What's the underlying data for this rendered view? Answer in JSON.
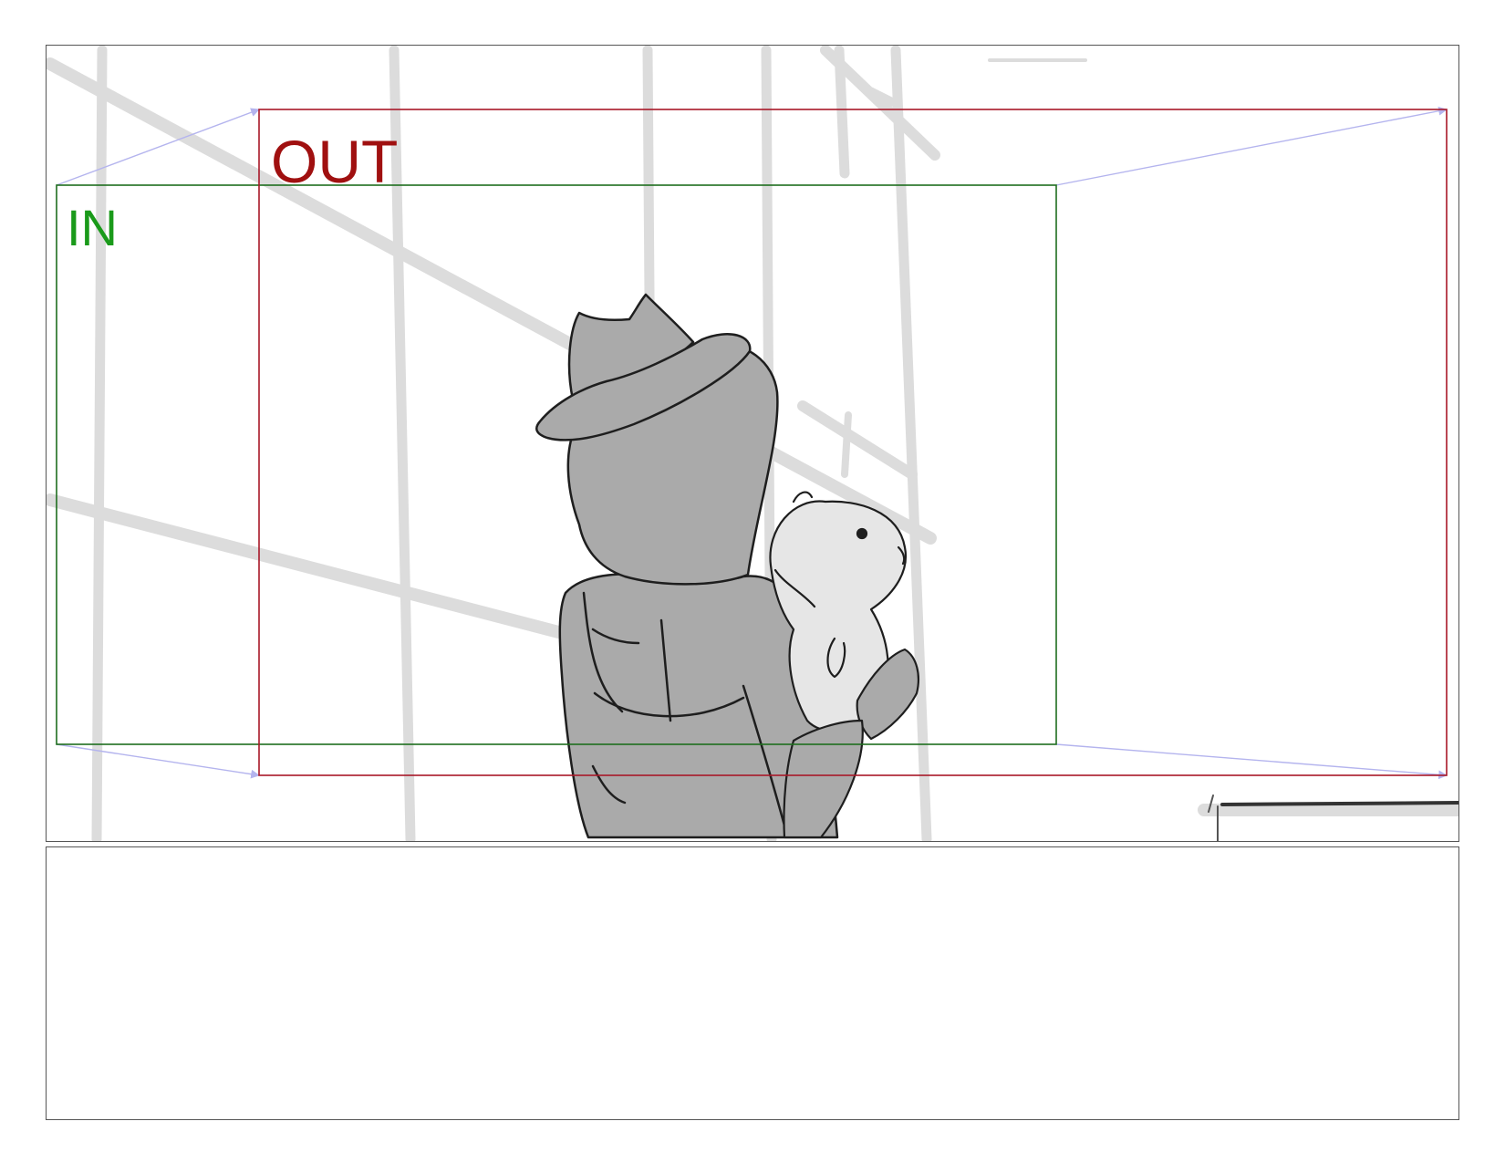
{
  "frames": {
    "in": {
      "label": "IN",
      "color": "#1a9a1a",
      "border_color": "#1f6e1f"
    },
    "out": {
      "label": "OUT",
      "color": "#a01010",
      "border_color": "#a81828"
    }
  },
  "colors": {
    "panel_border": "#555555",
    "camera_move_arrow": "#b4b4ee",
    "background_sketch": "#dcdcdc",
    "character_fill": "#aaaaaa",
    "dog_fill": "#e6e6e6",
    "ink": "#1e1e1e"
  },
  "icons": {
    "camera_move": "arrow-icon"
  },
  "notes": {
    "text": ""
  }
}
